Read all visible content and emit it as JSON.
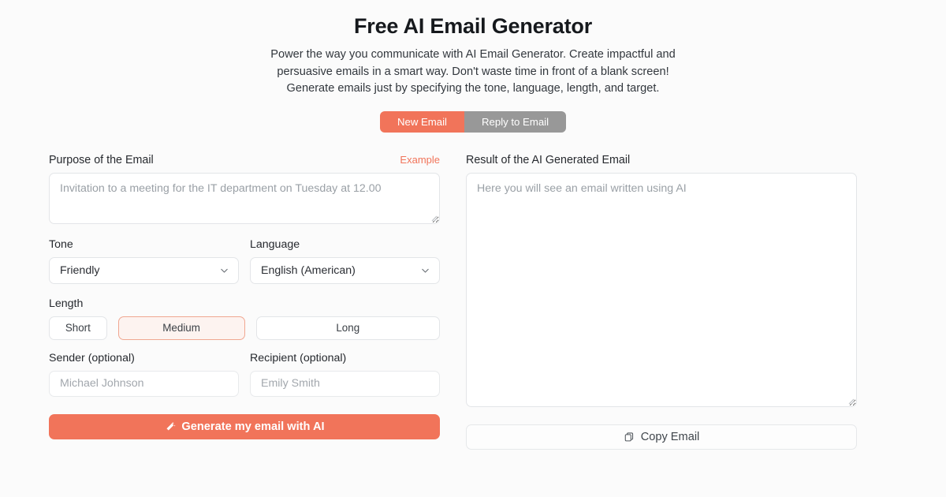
{
  "header": {
    "title": "Free AI Email Generator",
    "subtitle": "Power the way you communicate with AI Email Generator. Create impactful and persuasive emails in a smart way. Don't waste time in front of a blank screen! Generate emails just by specifying the tone, language, length, and target."
  },
  "tabs": {
    "items": [
      {
        "label": "New Email",
        "active": true
      },
      {
        "label": "Reply to Email",
        "active": false
      }
    ]
  },
  "left": {
    "purpose": {
      "label": "Purpose of the Email",
      "example_link": "Example",
      "placeholder": "Invitation to a meeting for the IT department on Tuesday at 12.00",
      "value": ""
    },
    "tone": {
      "label": "Tone",
      "selected": "Friendly"
    },
    "language": {
      "label": "Language",
      "selected": "English (American)"
    },
    "length": {
      "label": "Length",
      "options": [
        {
          "label": "Short",
          "selected": false
        },
        {
          "label": "Medium",
          "selected": true
        },
        {
          "label": "Long",
          "selected": false
        }
      ]
    },
    "sender": {
      "label": "Sender (optional)",
      "placeholder": "Michael Johnson",
      "value": ""
    },
    "recipient": {
      "label": "Recipient (optional)",
      "placeholder": "Emily Smith",
      "value": ""
    },
    "generate_button": {
      "label": "Generate my email with AI",
      "icon": "magic-wand-icon"
    }
  },
  "right": {
    "result": {
      "label": "Result of the AI Generated Email",
      "placeholder": "Here you will see an email written using AI",
      "value": ""
    },
    "copy_button": {
      "label": "Copy Email",
      "icon": "copy-icon"
    }
  },
  "colors": {
    "accent": "#f1745a",
    "inactive_tab": "#989898",
    "page_background": "#fbfbfb",
    "selected_length_border": "#f0a791",
    "selected_length_fill": "#fdf3f0",
    "input_border": "#e3e5e8",
    "placeholder_text": "#9aa0a6"
  }
}
